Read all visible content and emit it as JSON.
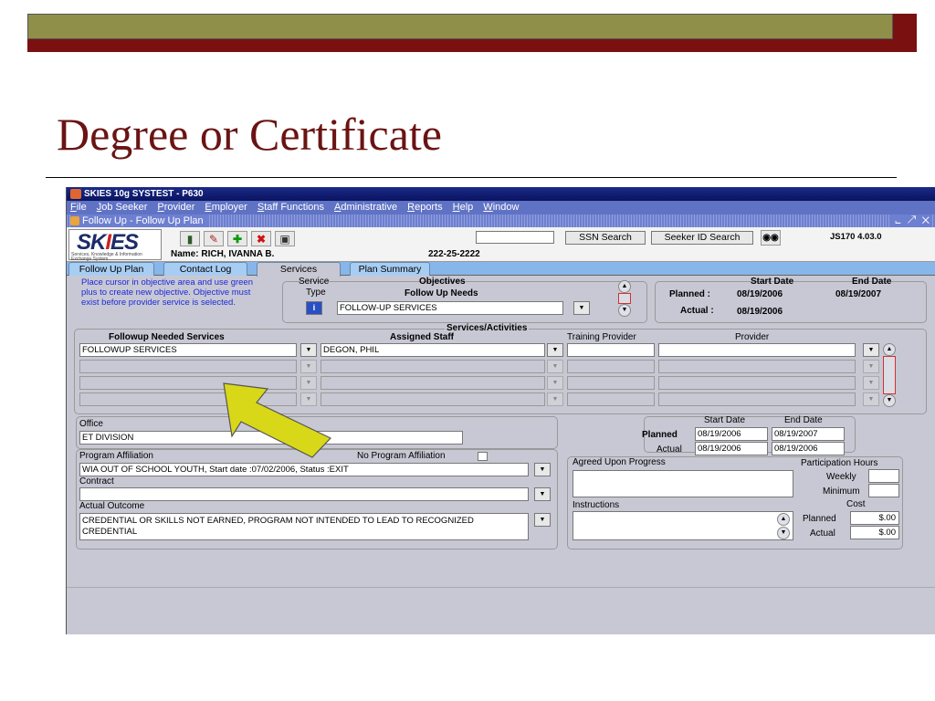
{
  "slide": {
    "title": "Degree or Certificate"
  },
  "app": {
    "title": "SKIES 10g SYSTEST - P630",
    "menu": [
      "File",
      "Job Seeker",
      "Provider",
      "Employer",
      "Staff Functions",
      "Administrative",
      "Reports",
      "Help",
      "Window"
    ],
    "form_title": "Follow Up - Follow Up Plan",
    "window_controls": "⨽ ↗ ✕"
  },
  "header": {
    "logo_text": "SKIES",
    "logo_subtitle": "Services, Knowledge & Information Exchange System",
    "name_label": "Name: RICH, IVANNA B.",
    "ssn": "222-25-2222",
    "ssn_search": "SSN Search",
    "seeker_search": "Seeker ID Search",
    "form_id": "JS170 4.03.0",
    "search_value": ""
  },
  "tabs": [
    "Follow Up Plan",
    "Contact Log",
    "Services",
    "Plan Summary"
  ],
  "hint": "Place cursor in objective area and use green plus to create new objective. Objective must exist before provider service is selected.",
  "objectives": {
    "service_label": "Service",
    "type_label": "Type",
    "title": "Objectives",
    "subtitle": "Follow Up Needs",
    "value": "FOLLOW-UP SERVICES",
    "type_icon": "i"
  },
  "dates_top": {
    "start_header": "Start Date",
    "end_header": "End Date",
    "planned_label": "Planned :",
    "planned_start": "08/19/2006",
    "planned_end": "08/19/2007",
    "actual_label": "Actual :",
    "actual_start": "08/19/2006"
  },
  "services": {
    "title": "Services/Activities",
    "col_needed": "Followup Needed Services",
    "col_staff": "Assigned Staff",
    "col_training": "Training Provider",
    "col_provider": "Provider",
    "rows": [
      {
        "service": "FOLLOWUP SERVICES",
        "staff": "DEGON, PHIL",
        "training": "",
        "provider": ""
      },
      {
        "service": "",
        "staff": "",
        "training": "",
        "provider": ""
      },
      {
        "service": "",
        "staff": "",
        "training": "",
        "provider": ""
      },
      {
        "service": "",
        "staff": "",
        "training": "",
        "provider": ""
      }
    ]
  },
  "office": {
    "label": "Office",
    "value": "ET DIVISION"
  },
  "dates_bottom": {
    "start_header": "Start Date",
    "end_header": "End Date",
    "planned_label": "Planned",
    "planned_start": "08/19/2006",
    "planned_end": "08/19/2007",
    "actual_label": "Actual",
    "actual_start": "08/19/2006",
    "actual_end": "08/19/2006"
  },
  "program": {
    "label": "Program Affiliation",
    "no_affiliation_label": "No Program Affiliation",
    "value": "WIA OUT OF SCHOOL YOUTH, Start date :07/02/2006, Status :EXIT",
    "contract_label": "Contract",
    "contract_value": "",
    "outcome_label": "Actual Outcome",
    "outcome_value": "CREDENTIAL OR SKILLS NOT EARNED, PROGRAM NOT INTENDED TO LEAD TO RECOGNIZED CREDENTIAL"
  },
  "progress": {
    "agreed_label": "Agreed Upon Progress",
    "instructions_label": "Instructions",
    "participation_label": "Participation Hours",
    "weekly_label": "Weekly",
    "minimum_label": "Minimum",
    "cost_label": "Cost",
    "planned_label": "Planned",
    "planned_cost": "$.00",
    "actual_label": "Actual",
    "actual_cost": "$.00"
  },
  "colors": {
    "slide_title": "#6b1313",
    "hint_text": "#1a2ad8",
    "arrow_fill": "#d8d818",
    "app_bg": "#c8c8d4"
  }
}
